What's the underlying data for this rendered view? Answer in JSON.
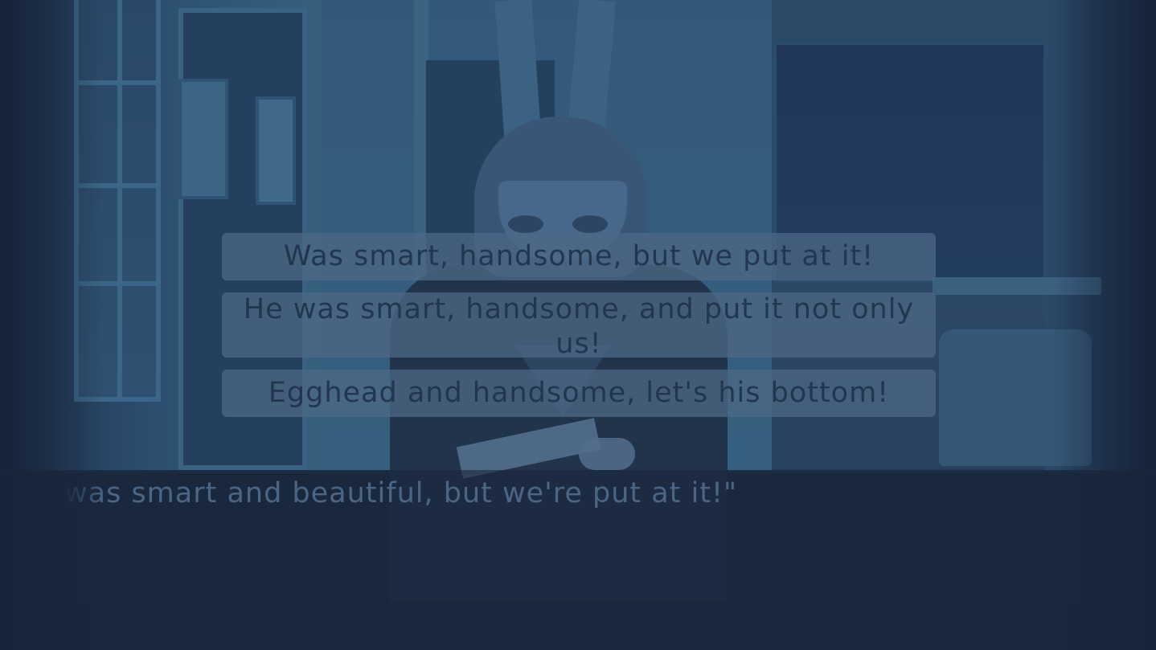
{
  "choices": [
    {
      "label": "Was smart, handsome, but we put at it!"
    },
    {
      "label": "He was smart, handsome, and put it not only us!"
    },
    {
      "label": "Egghead and handsome, let's his bottom!"
    }
  ],
  "dialogue": {
    "text": "was smart and beautiful, but we're put at it!\""
  },
  "colors": {
    "choice_background": "#4e6886",
    "choice_text": "#22364f",
    "dialogue_text": "#4a6684",
    "scene_tint": "#2b4a68"
  }
}
